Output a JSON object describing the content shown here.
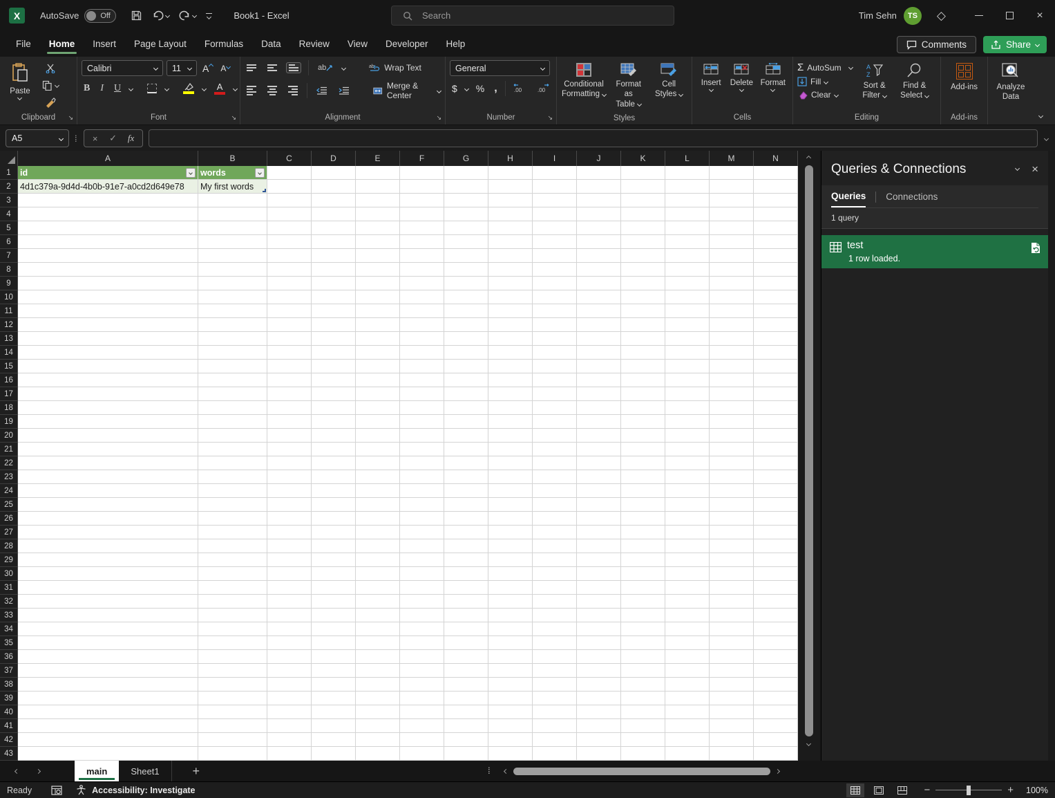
{
  "titlebar": {
    "autosave_label": "AutoSave",
    "autosave_state": "Off",
    "title": "Book1  -  Excel",
    "search_placeholder": "Search",
    "user_name": "Tim Sehn",
    "user_initials": "TS"
  },
  "menu": {
    "tabs": [
      {
        "label": "File"
      },
      {
        "label": "Home",
        "active": true
      },
      {
        "label": "Insert"
      },
      {
        "label": "Page Layout"
      },
      {
        "label": "Formulas"
      },
      {
        "label": "Data"
      },
      {
        "label": "Review"
      },
      {
        "label": "View"
      },
      {
        "label": "Developer"
      },
      {
        "label": "Help"
      }
    ],
    "comments_label": "Comments",
    "share_label": "Share"
  },
  "ribbon": {
    "clipboard": {
      "label": "Clipboard",
      "paste": "Paste"
    },
    "font": {
      "label": "Font",
      "name": "Calibri",
      "size": "11"
    },
    "alignment": {
      "label": "Alignment",
      "wrap_text": "Wrap Text",
      "merge_center": "Merge & Center"
    },
    "number": {
      "label": "Number",
      "format": "General"
    },
    "styles": {
      "label": "Styles",
      "conditional_1": "Conditional",
      "conditional_2": "Formatting",
      "format_table_1": "Format as",
      "format_table_2": "Table",
      "cell_styles_1": "Cell",
      "cell_styles_2": "Styles"
    },
    "cells": {
      "label": "Cells",
      "insert": "Insert",
      "delete": "Delete",
      "format": "Format"
    },
    "editing": {
      "label": "Editing",
      "autosum": "AutoSum",
      "fill": "Fill",
      "clear": "Clear",
      "sort_filter_1": "Sort &",
      "sort_filter_2": "Filter",
      "find_select_1": "Find &",
      "find_select_2": "Select"
    },
    "addins": {
      "label": "Add-ins",
      "button": "Add-ins"
    },
    "analyze": {
      "line1": "Analyze",
      "line2": "Data"
    }
  },
  "formula_bar": {
    "name_box": "A5",
    "fx": "fx",
    "formula_value": ""
  },
  "grid": {
    "columns": [
      "A",
      "B",
      "C",
      "D",
      "E",
      "F",
      "G",
      "H",
      "I",
      "J",
      "K",
      "L",
      "M",
      "N"
    ],
    "row_count": 43,
    "cells": {
      "A1": "id",
      "B1": "words",
      "A2": "4d1c379a-9d4d-4b0b-91e7-a0cd2d649e78",
      "B2": "My first words"
    }
  },
  "panel": {
    "title": "Queries & Connections",
    "tab_queries": "Queries",
    "tab_connections": "Connections",
    "count_label": "1 query",
    "query": {
      "name": "test",
      "status": "1 row loaded."
    }
  },
  "sheet_bar": {
    "tabs": [
      {
        "label": "main",
        "active": true
      },
      {
        "label": "Sheet1"
      }
    ],
    "add_label": "+"
  },
  "status_bar": {
    "ready": "Ready",
    "accessibility": "Accessibility: Investigate",
    "zoom_level": "100%"
  },
  "colors": {
    "table_header_green": "#70a75a",
    "table_band_green": "#eaf1e4",
    "query_selected_green": "#1f7143",
    "share_green": "#2e9e57",
    "excel_brand_green": "#1d7044"
  }
}
